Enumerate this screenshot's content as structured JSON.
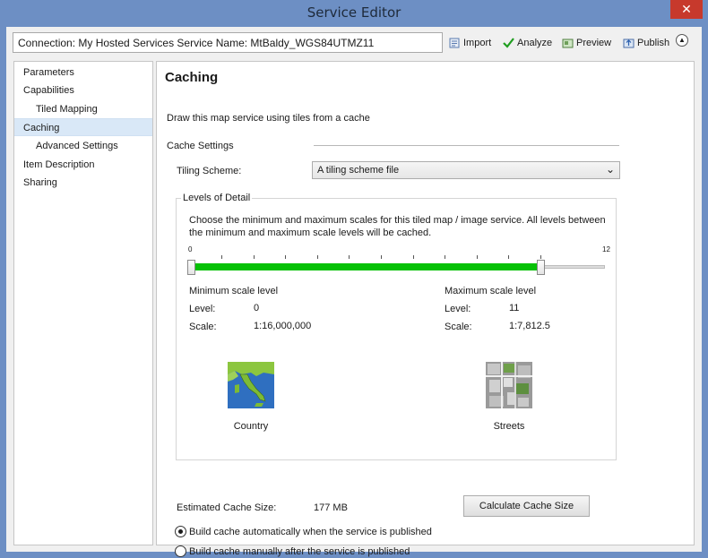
{
  "window": {
    "title": "Service Editor",
    "close_glyph": "✕"
  },
  "toolbar": {
    "connection": "Connection: My Hosted Services   Service Name: MtBaldy_WGS84UTMZ11",
    "import_label": "Import",
    "analyze_label": "Analyze",
    "preview_label": "Preview",
    "publish_label": "Publish"
  },
  "nav": {
    "items": [
      {
        "label": "Parameters"
      },
      {
        "label": "Capabilities"
      },
      {
        "label": "Tiled Mapping"
      },
      {
        "label": "Caching"
      },
      {
        "label": "Advanced Settings"
      },
      {
        "label": "Item Description"
      },
      {
        "label": "Sharing"
      }
    ],
    "selected": "Caching"
  },
  "caching": {
    "title": "Caching",
    "description": "Draw this map service using tiles from a cache",
    "cache_settings_label": "Cache Settings",
    "tiling_scheme_label": "Tiling Scheme:",
    "tiling_scheme_value": "A tiling scheme file",
    "lod_legend": "Levels of Detail",
    "lod_text": "Choose the minimum and maximum scales for this tiled map / image service. All levels between the minimum and maximum scale levels will be cached.",
    "slider": {
      "min_label": "0",
      "max_label": "12",
      "tick_count": 12,
      "low": 0,
      "high": 11,
      "max": 12
    },
    "min": {
      "header": "Minimum scale level",
      "level_label": "Level:",
      "level": "0",
      "scale_label": "Scale:",
      "scale": "1:16,000,000",
      "caption": "Country"
    },
    "max": {
      "header": "Maximum scale level",
      "level_label": "Level:",
      "level": "11",
      "scale_label": "Scale:",
      "scale": "1:7,812.5",
      "caption": "Streets"
    },
    "est_label": "Estimated Cache Size:",
    "est_value": "177 MB",
    "calc_button": "Calculate Cache Size",
    "radio_auto": "Build cache automatically when the service is published",
    "radio_manual": "Build cache manually after the service is published"
  },
  "colors": {
    "accent_green": "#06c106",
    "title_bar": "#6d8fc4",
    "close_red": "#c7392c"
  }
}
